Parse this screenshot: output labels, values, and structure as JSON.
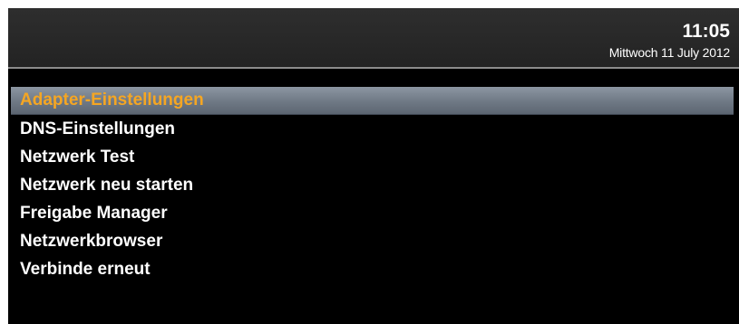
{
  "header": {
    "time": "11:05",
    "date": "Mittwoch 11 July 2012"
  },
  "menu": {
    "items": [
      {
        "label": "Adapter-Einstellungen",
        "selected": true
      },
      {
        "label": "DNS-Einstellungen",
        "selected": false
      },
      {
        "label": "Netzwerk Test",
        "selected": false
      },
      {
        "label": "Netzwerk neu starten",
        "selected": false
      },
      {
        "label": "Freigabe Manager",
        "selected": false
      },
      {
        "label": "Netzwerkbrowser",
        "selected": false
      },
      {
        "label": "Verbinde erneut",
        "selected": false
      }
    ]
  },
  "colors": {
    "background": "#000000",
    "header": "#2a2a2a",
    "selection_bar": "#7d8794",
    "selected_text": "#f5a623",
    "text": "#ffffff"
  }
}
